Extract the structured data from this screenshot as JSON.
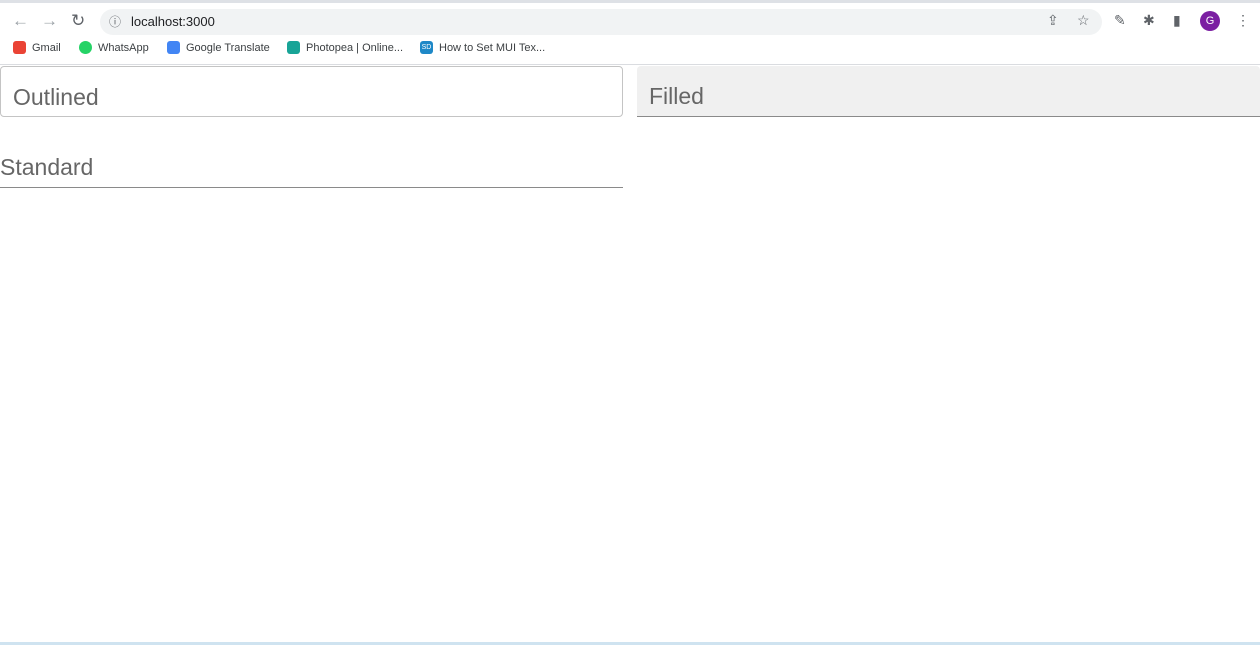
{
  "browser": {
    "url": "localhost:3000",
    "avatar_letter": "G",
    "bookmarks": [
      {
        "label": "Gmail",
        "color": "#ea4335"
      },
      {
        "label": "WhatsApp",
        "color": "#25d366"
      },
      {
        "label": "Google Translate",
        "color": "#4285f4"
      },
      {
        "label": "Photopea | Online...",
        "color": "#18a497"
      },
      {
        "label": "How to Set MUI Tex...",
        "color": "#1e88c7"
      }
    ]
  },
  "fields": {
    "outlined": "Outlined",
    "filled": "Filled",
    "standard": "Standard"
  }
}
